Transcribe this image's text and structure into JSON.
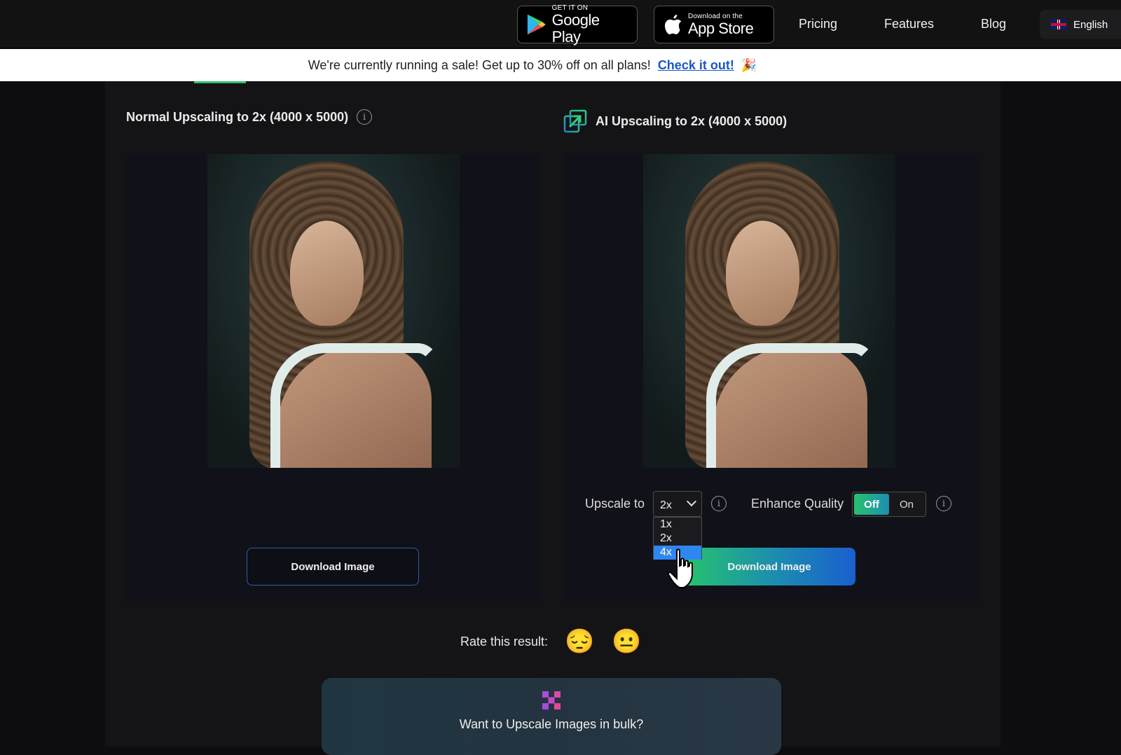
{
  "nav": {
    "google_play": {
      "small": "GET IT ON",
      "big": "Google Play"
    },
    "app_store": {
      "small": "Download on the",
      "big": "App Store"
    },
    "links": [
      "Pricing",
      "Features",
      "Blog"
    ],
    "language": "English"
  },
  "banner": {
    "message": "We're currently running a sale! Get up to 30% off on all plans!",
    "cta": "Check it out!",
    "emoji": "🎉"
  },
  "normal": {
    "title": "Normal Upscaling to 2x (4000 x 5000)",
    "download_label": "Download Image"
  },
  "ai": {
    "title": "AI Upscaling to 2x (4000 x 5000)",
    "download_label": "Download Image",
    "upscale_label": "Upscale to",
    "upscale_value": "2x",
    "upscale_options": [
      "1x",
      "2x",
      "4x"
    ],
    "upscale_highlighted": "4x",
    "enhance_label": "Enhance Quality",
    "enhance_off": "Off",
    "enhance_on": "On",
    "enhance_state": "Off"
  },
  "rating": {
    "label": "Rate this result:",
    "options": [
      "😔",
      "😐"
    ]
  },
  "bulk": {
    "text": "Want to Upscale Images in bulk?"
  },
  "colors": {
    "accent_green": "#26c46d",
    "accent_blue": "#1a5fcf",
    "link_blue": "#1a56c9",
    "dropdown_highlight": "#2f86f0"
  }
}
